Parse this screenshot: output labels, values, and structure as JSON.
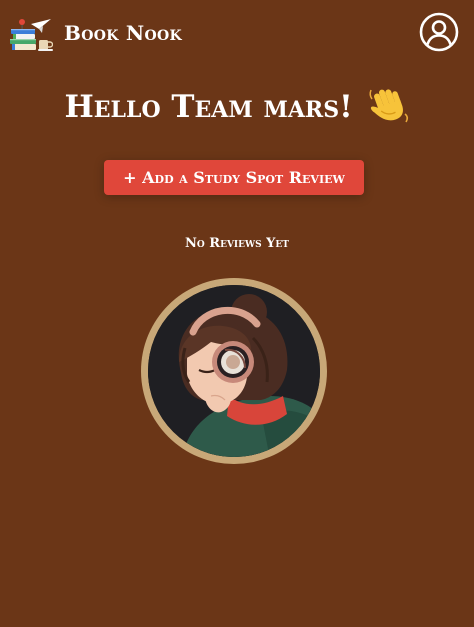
{
  "header": {
    "brand": "Book Nook",
    "logo_icon": "book-stack-icon",
    "profile_icon": "user-circle-icon"
  },
  "main": {
    "greeting": "Hello Team mars!",
    "greeting_emoji": "waving-hand-icon",
    "add_review_label": "+ Add a Study Spot Review",
    "empty_message": "No Reviews Yet",
    "illustration": "lofi-girl-headphones-illustration"
  },
  "colors": {
    "background": "#6b3617",
    "button": "#e0473a",
    "text": "#ffffff",
    "avatar_ring": "#c8a878"
  }
}
